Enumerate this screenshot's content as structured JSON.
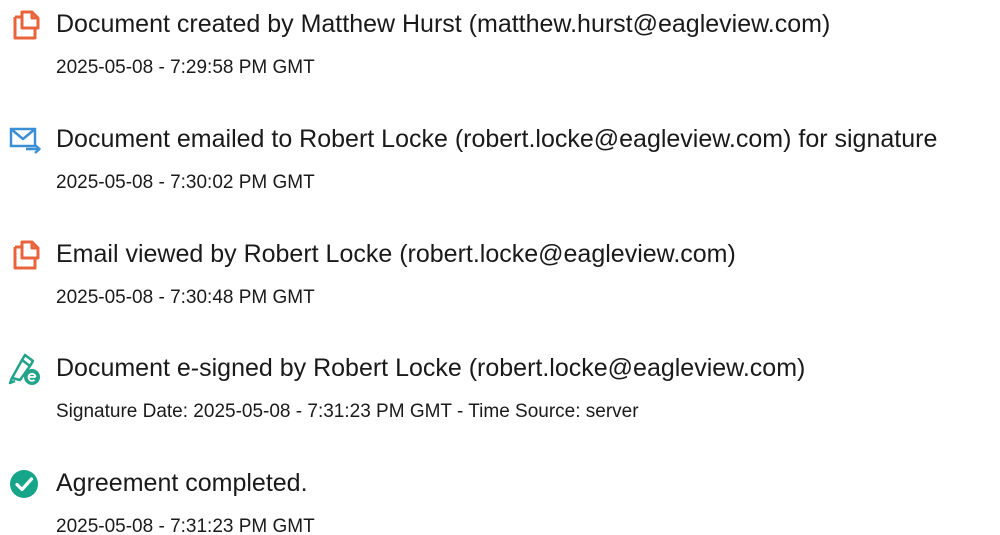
{
  "colors": {
    "doc_icon": "#e8643c",
    "mail_icon": "#3d8fd4",
    "sign_icon": "#22a38a",
    "complete_icon": "#17a589",
    "text": "#1a1a1a"
  },
  "events": [
    {
      "icon": "document-created-icon",
      "title": "Document created by Matthew Hurst (matthew.hurst@eagleview.com)",
      "time": "2025-05-08 - 7:29:58 PM GMT"
    },
    {
      "icon": "email-sent-icon",
      "title": "Document emailed to Robert Locke (robert.locke@eagleview.com) for signature",
      "time": "2025-05-08 - 7:30:02 PM GMT"
    },
    {
      "icon": "email-viewed-icon",
      "title": "Email viewed by Robert Locke (robert.locke@eagleview.com)",
      "time": "2025-05-08 - 7:30:48 PM GMT"
    },
    {
      "icon": "e-signed-icon",
      "title": "Document e-signed by Robert Locke (robert.locke@eagleview.com)",
      "time": "Signature Date: 2025-05-08 - 7:31:23 PM GMT - Time Source: server"
    },
    {
      "icon": "agreement-completed-icon",
      "title": "Agreement completed.",
      "time": "2025-05-08 - 7:31:23 PM GMT"
    }
  ]
}
